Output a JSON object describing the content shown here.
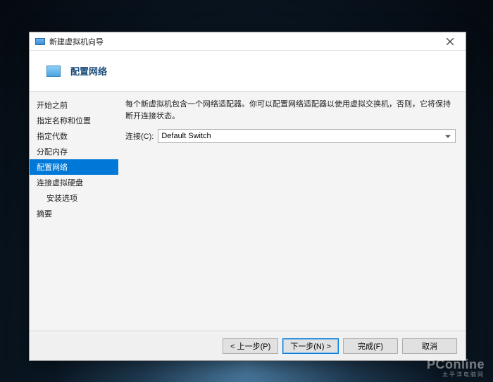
{
  "titlebar": {
    "title": "新建虚拟机向导"
  },
  "header": {
    "title": "配置网络"
  },
  "sidebar": {
    "items": [
      {
        "label": "开始之前",
        "indent": false
      },
      {
        "label": "指定名称和位置",
        "indent": false
      },
      {
        "label": "指定代数",
        "indent": false
      },
      {
        "label": "分配内存",
        "indent": false
      },
      {
        "label": "配置网络",
        "indent": false,
        "selected": true
      },
      {
        "label": "连接虚拟硬盘",
        "indent": false
      },
      {
        "label": "安装选项",
        "indent": true
      },
      {
        "label": "摘要",
        "indent": false
      }
    ]
  },
  "content": {
    "description": "每个新虚拟机包含一个网络适配器。你可以配置网络适配器以使用虚拟交换机，否则，它将保持断开连接状态。",
    "connection_label": "连接(C):",
    "connection_value": "Default Switch"
  },
  "footer": {
    "prev": "< 上一步(P)",
    "next": "下一步(N) >",
    "finish": "完成(F)",
    "cancel": "取消"
  },
  "watermark": {
    "main": "PConline",
    "sub": "太平洋电脑网"
  }
}
